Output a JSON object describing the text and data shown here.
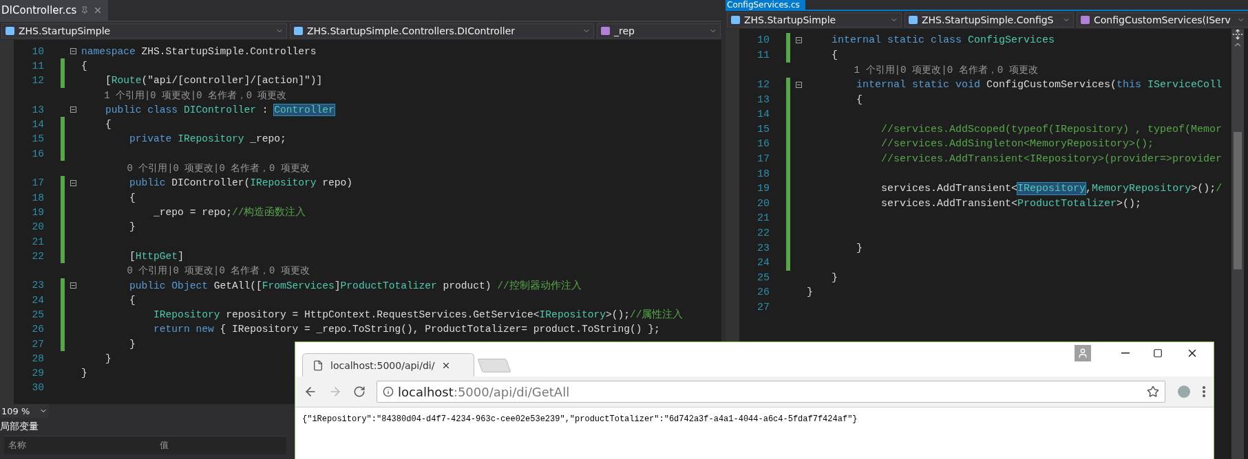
{
  "left_editor": {
    "tab": {
      "title": "DIController.cs"
    },
    "nav": [
      "ZHS.StartupSimple",
      "ZHS.StartupSimple.Controllers.DIController",
      "_rep"
    ],
    "lines": [
      {
        "kind": "code",
        "num": "10",
        "fold": true,
        "changed": false,
        "tokens": [
          {
            "kind": "kw",
            "text": "namespace"
          },
          {
            "kind": "plain",
            "text": " ZHS.StartupSimple.Controllers"
          }
        ]
      },
      {
        "kind": "code",
        "num": "11",
        "fold": false,
        "changed": true,
        "tokens": [
          {
            "kind": "plain",
            "text": "{"
          }
        ]
      },
      {
        "kind": "code",
        "num": "12",
        "fold": false,
        "changed": true,
        "tokens": [
          {
            "kind": "plain",
            "text": "    ["
          },
          {
            "kind": "type",
            "text": "Route"
          },
          {
            "kind": "plain",
            "text": "(″api/[controller]/[action]″)]"
          }
        ]
      },
      {
        "kind": "hint",
        "text": "    1 个引用|0 项更改|0 名作者，0 项更改"
      },
      {
        "kind": "code",
        "num": "13",
        "fold": true,
        "changed": false,
        "tokens": [
          {
            "kind": "kw",
            "text": "    public class"
          },
          {
            "kind": "type",
            "text": " DIController"
          },
          {
            "kind": "plain",
            "text": " : "
          },
          {
            "kind": "ref",
            "text": "Controller"
          }
        ]
      },
      {
        "kind": "code",
        "num": "14",
        "fold": false,
        "changed": true,
        "tokens": [
          {
            "kind": "plain",
            "text": "    {"
          }
        ]
      },
      {
        "kind": "code",
        "num": "15",
        "fold": false,
        "changed": true,
        "tokens": [
          {
            "kind": "kw",
            "text": "        private"
          },
          {
            "kind": "type",
            "text": " IRepository"
          },
          {
            "kind": "plain",
            "text": " _repo;"
          }
        ]
      },
      {
        "kind": "code",
        "num": "16",
        "fold": false,
        "changed": true
      },
      {
        "kind": "hint",
        "text": "        0 个引用|0 项更改|0 名作者，0 项更改"
      },
      {
        "kind": "code",
        "num": "17",
        "fold": true,
        "changed": true,
        "tokens": [
          {
            "kind": "kw",
            "text": "        public"
          },
          {
            "kind": "plain",
            "text": " DIController("
          },
          {
            "kind": "type",
            "text": "IRepository"
          },
          {
            "kind": "plain",
            "text": " repo)"
          }
        ]
      },
      {
        "kind": "code",
        "num": "18",
        "fold": false,
        "changed": true,
        "tokens": [
          {
            "kind": "plain",
            "text": "        {"
          }
        ]
      },
      {
        "kind": "code",
        "num": "19",
        "fold": false,
        "changed": true,
        "tokens": [
          {
            "kind": "plain",
            "text": "            _repo = repo;"
          },
          {
            "kind": "comment",
            "text": "//构造函数注入"
          }
        ]
      },
      {
        "kind": "code",
        "num": "20",
        "fold": false,
        "changed": true,
        "tokens": [
          {
            "kind": "plain",
            "text": "        }"
          }
        ]
      },
      {
        "kind": "code",
        "num": "21",
        "fold": false,
        "changed": true
      },
      {
        "kind": "code",
        "num": "22",
        "fold": false,
        "changed": true,
        "tokens": [
          {
            "kind": "plain",
            "text": "        ["
          },
          {
            "kind": "type",
            "text": "HttpGet"
          },
          {
            "kind": "plain",
            "text": "]"
          }
        ]
      },
      {
        "kind": "hint",
        "text": "        0 个引用|0 项更改|0 名作者，0 项更改"
      },
      {
        "kind": "code",
        "num": "23",
        "fold": true,
        "changed": true,
        "tokens": [
          {
            "kind": "kw",
            "text": "        public Object"
          },
          {
            "kind": "plain",
            "text": " GetAll(["
          },
          {
            "kind": "type",
            "text": "FromServices"
          },
          {
            "kind": "plain",
            "text": "]"
          },
          {
            "kind": "type",
            "text": "ProductTotalizer"
          },
          {
            "kind": "plain",
            "text": " product) "
          },
          {
            "kind": "comment",
            "text": "//控制器动作注入"
          }
        ]
      },
      {
        "kind": "code",
        "num": "24",
        "fold": false,
        "changed": true,
        "tokens": [
          {
            "kind": "plain",
            "text": "        {"
          }
        ]
      },
      {
        "kind": "code",
        "num": "25",
        "fold": false,
        "changed": true,
        "tokens": [
          {
            "kind": "type",
            "text": "            IRepository"
          },
          {
            "kind": "plain",
            "text": " repository = HttpContext.RequestServices.GetService<"
          },
          {
            "kind": "type",
            "text": "IRepository"
          },
          {
            "kind": "plain",
            "text": ">();"
          },
          {
            "kind": "comment",
            "text": "//属性注入"
          }
        ]
      },
      {
        "kind": "code",
        "num": "26",
        "fold": false,
        "changed": true,
        "tokens": [
          {
            "kind": "kw",
            "text": "            return new"
          },
          {
            "kind": "plain",
            "text": " { IRepository = _repo.ToString(), ProductTotalizer= product.ToString() };"
          }
        ]
      },
      {
        "kind": "code",
        "num": "27",
        "fold": false,
        "changed": true,
        "tokens": [
          {
            "kind": "plain",
            "text": "        }"
          }
        ]
      },
      {
        "kind": "code",
        "num": "28",
        "fold": false,
        "changed": false,
        "tokens": [
          {
            "kind": "plain",
            "text": "    }"
          }
        ]
      },
      {
        "kind": "code",
        "num": "29",
        "fold": false,
        "changed": false,
        "tokens": [
          {
            "kind": "plain",
            "text": "}"
          }
        ]
      },
      {
        "kind": "code",
        "num": "30",
        "fold": false,
        "changed": false
      }
    ],
    "zoom": "109 %",
    "locals": {
      "title": "局部变量",
      "columns": [
        "名称",
        "值"
      ]
    }
  },
  "right_editor": {
    "tab": {
      "title": "ConfigServices.cs"
    },
    "nav": [
      "ZHS.StartupSimple",
      "ZHS.StartupSimple.ConfigS",
      "ConfigCustomServices(IServ"
    ],
    "lines": [
      {
        "kind": "code",
        "num": "10",
        "fold": true,
        "changed": true,
        "tokens": [
          {
            "kind": "kw",
            "text": "    internal static class"
          },
          {
            "kind": "type",
            "text": " ConfigServices"
          }
        ]
      },
      {
        "kind": "code",
        "num": "11",
        "fold": false,
        "changed": true,
        "tokens": [
          {
            "kind": "plain",
            "text": "    {"
          }
        ]
      },
      {
        "kind": "hint",
        "text": "        1 个引用|0 项更改|0 名作者，0 项更改"
      },
      {
        "kind": "code",
        "num": "12",
        "fold": true,
        "changed": true,
        "tokens": [
          {
            "kind": "kw",
            "text": "        internal static void"
          },
          {
            "kind": "plain",
            "text": " ConfigCustomServices("
          },
          {
            "kind": "kw",
            "text": "this"
          },
          {
            "kind": "type",
            "text": " IServiceColl"
          }
        ]
      },
      {
        "kind": "code",
        "num": "13",
        "fold": false,
        "changed": true,
        "tokens": [
          {
            "kind": "plain",
            "text": "        {"
          }
        ]
      },
      {
        "kind": "code",
        "num": "14",
        "fold": false,
        "changed": true
      },
      {
        "kind": "code",
        "num": "15",
        "fold": false,
        "changed": true,
        "tokens": [
          {
            "kind": "comment",
            "text": "            //services.AddScoped(typeof(IRepository) , typeof(Memor"
          }
        ]
      },
      {
        "kind": "code",
        "num": "16",
        "fold": false,
        "changed": true,
        "tokens": [
          {
            "kind": "comment",
            "text": "            //services.AddSingleton<MemoryRepository>();"
          }
        ]
      },
      {
        "kind": "code",
        "num": "17",
        "fold": false,
        "changed": true,
        "tokens": [
          {
            "kind": "comment",
            "text": "            //services.AddTransient<IRepository>(provider=>provider"
          }
        ]
      },
      {
        "kind": "code",
        "num": "18",
        "fold": false,
        "changed": true
      },
      {
        "kind": "code",
        "num": "19",
        "fold": false,
        "changed": true,
        "tokens": [
          {
            "kind": "plain",
            "text": "            services.AddTransient<"
          },
          {
            "kind": "ref",
            "text": "IRepository"
          },
          {
            "kind": "plain",
            "text": ","
          },
          {
            "kind": "type",
            "text": "MemoryRepository"
          },
          {
            "kind": "plain",
            "text": ">();"
          },
          {
            "kind": "comment",
            "text": "/"
          }
        ]
      },
      {
        "kind": "code",
        "num": "20",
        "fold": false,
        "changed": true,
        "tokens": [
          {
            "kind": "plain",
            "text": "            services.AddTransient<"
          },
          {
            "kind": "type",
            "text": "ProductTotalizer"
          },
          {
            "kind": "plain",
            "text": ">();"
          }
        ]
      },
      {
        "kind": "code",
        "num": "21",
        "fold": false,
        "changed": true
      },
      {
        "kind": "code",
        "num": "22",
        "fold": false,
        "changed": true
      },
      {
        "kind": "code",
        "num": "23",
        "fold": false,
        "changed": true,
        "tokens": [
          {
            "kind": "plain",
            "text": "        }"
          }
        ]
      },
      {
        "kind": "code",
        "num": "24",
        "fold": false,
        "changed": true
      },
      {
        "kind": "code",
        "num": "25",
        "fold": false,
        "changed": false,
        "tokens": [
          {
            "kind": "plain",
            "text": "    }"
          }
        ]
      },
      {
        "kind": "code",
        "num": "26",
        "fold": false,
        "changed": false,
        "tokens": [
          {
            "kind": "plain",
            "text": "}"
          }
        ]
      },
      {
        "kind": "code",
        "num": "27",
        "fold": false,
        "changed": false
      }
    ]
  },
  "browser": {
    "tab": {
      "title": "localhost:5000/api/di/"
    },
    "address": {
      "host": "localhost",
      "path": ":5000/api/di/GetAll"
    },
    "body": "{\"iRepository\":\"84380d04-d4f7-4234-963c-cee02e53e239\",\"productTotalizer\":\"6d742a3f-a4a1-4044-a6c4-5fdaf7f424af\"}"
  }
}
